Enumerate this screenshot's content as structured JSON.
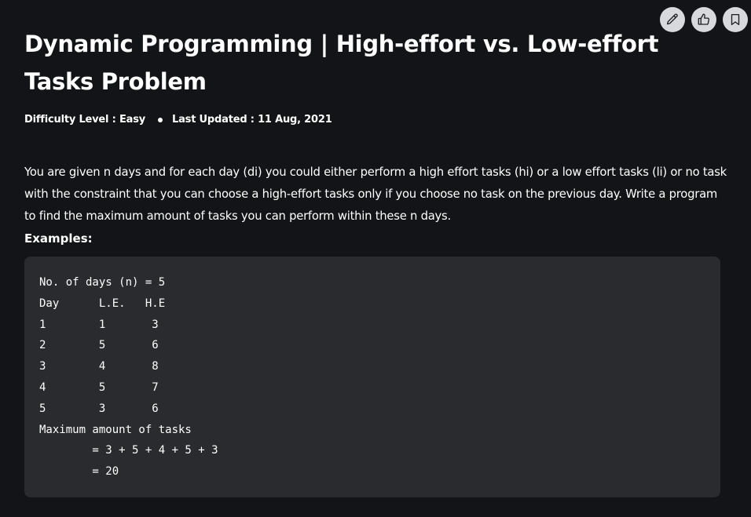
{
  "toolbar": {
    "buttons": [
      {
        "icon": "pencil-icon",
        "name": "edit-button"
      },
      {
        "icon": "thumbs-up-icon",
        "name": "like-button"
      },
      {
        "icon": "bookmark-icon",
        "name": "bookmark-button"
      }
    ]
  },
  "article": {
    "title": "Dynamic Programming | High-effort vs. Low-effort Tasks Problem",
    "difficulty": "Difficulty Level : Easy",
    "last_updated": "Last Updated : 11 Aug, 2021",
    "description": "You are given n days and for each day (di) you could either perform a high effort tasks (hi) or a low effort tasks (li) or no task with the constraint that you can choose a high-effort tasks only if you choose no task on the previous day. Write a program to find the maximum amount of tasks you can perform within these n days.",
    "examples_label": "Examples:",
    "example_code": "No. of days (n) = 5\nDay      L.E.   H.E\n1        1       3\n2        5       6\n3        4       8\n4        5       7\n5        3       6\nMaximum amount of tasks \n        = 3 + 5 + 4 + 5 + 3 \n        = 20"
  }
}
